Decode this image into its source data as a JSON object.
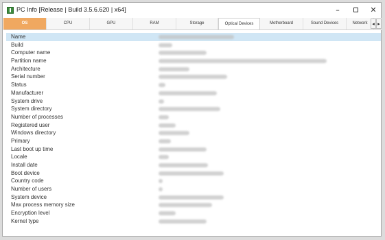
{
  "window": {
    "title": "PC Info [Release | Build 3.5.6.620 | x64]",
    "icon": "pc-info-app-icon",
    "controls": {
      "minimize": "–",
      "maximize": "maximize-icon",
      "close": "✕"
    }
  },
  "tabs": {
    "items": [
      {
        "label": "OS"
      },
      {
        "label": "CPU"
      },
      {
        "label": "GPU"
      },
      {
        "label": "RAM"
      },
      {
        "label": "Storage"
      },
      {
        "label": "Optical Devices"
      },
      {
        "label": "Motherboard"
      },
      {
        "label": "Sound Devices"
      },
      {
        "label": "Network"
      }
    ],
    "scroll_left": "◂",
    "scroll_right": "▸",
    "colors": {
      "os_tab": "#f0a860",
      "selected_row": "#d0e6f5"
    }
  },
  "properties": [
    {
      "label": "Name"
    },
    {
      "label": "Build"
    },
    {
      "label": "Computer name"
    },
    {
      "label": "Partition name"
    },
    {
      "label": "Architecture"
    },
    {
      "label": "Serial number"
    },
    {
      "label": "Status"
    },
    {
      "label": "Manufacturer"
    },
    {
      "label": "System drive"
    },
    {
      "label": "System directory"
    },
    {
      "label": "Number of processes"
    },
    {
      "label": "Registered user"
    },
    {
      "label": "Windows directory"
    },
    {
      "label": "Primary"
    },
    {
      "label": "Last boot up time"
    },
    {
      "label": "Locale"
    },
    {
      "label": "Install date"
    },
    {
      "label": "Boot device"
    },
    {
      "label": "Country code"
    },
    {
      "label": "Number of users"
    },
    {
      "label": "System device"
    },
    {
      "label": "Max process memory size"
    },
    {
      "label": "Encryption level"
    },
    {
      "label": "Kernel type"
    }
  ]
}
